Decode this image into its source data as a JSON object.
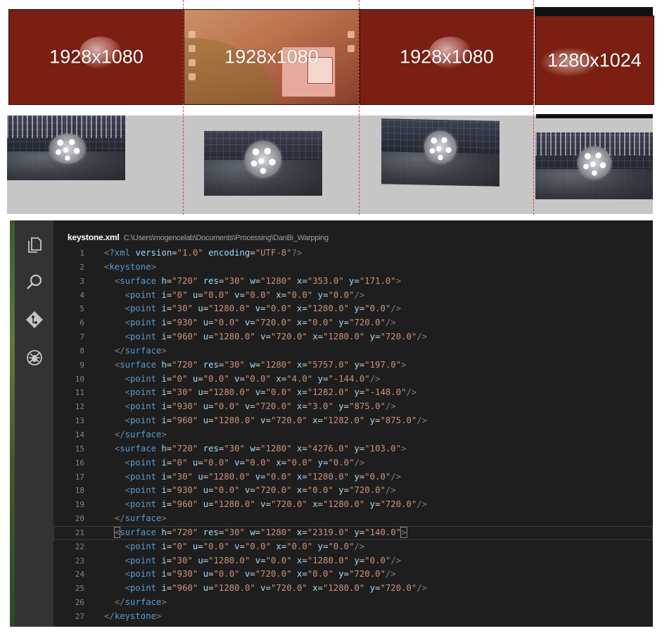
{
  "displays_top": [
    {
      "label": "1928x1080"
    },
    {
      "label": "1928x1080"
    },
    {
      "label": "1928x1080"
    },
    {
      "label": "1280x1024"
    }
  ],
  "colors": {
    "display_fill": "#7a1f12",
    "divider": "#e0403a",
    "warp_background": "#c6c6c6",
    "editor_bg": "#1e1e1e",
    "activity_bar": "#333333",
    "tag": "#569cd6",
    "attribute": "#9cdcfe",
    "string": "#ce9178"
  },
  "editor": {
    "file_name": "keystone.xml",
    "file_path": "C:\\Users\\mogencelab\\Documents\\Processing\\DanBi_Warpping",
    "activity_icons": [
      "explorer-icon",
      "search-icon",
      "source-control-icon",
      "debug-icon"
    ],
    "active_line": 21,
    "lines": [
      {
        "n": "1",
        "indent": 0,
        "kind": "decl",
        "tag": "?xml",
        "attrs": [
          [
            "version",
            "1.0"
          ],
          [
            "encoding",
            "UTF-8"
          ]
        ],
        "close": "?>"
      },
      {
        "n": "2",
        "indent": 0,
        "kind": "open",
        "tag": "keystone",
        "attrs": [],
        "close": ">"
      },
      {
        "n": "3",
        "indent": 1,
        "kind": "open",
        "tag": "surface",
        "attrs": [
          [
            "h",
            "720"
          ],
          [
            "res",
            "30"
          ],
          [
            "w",
            "1280"
          ],
          [
            "x",
            "353.0"
          ],
          [
            "y",
            "171.0"
          ]
        ],
        "close": ">"
      },
      {
        "n": "4",
        "indent": 2,
        "kind": "open",
        "tag": "point",
        "attrs": [
          [
            "i",
            "0"
          ],
          [
            "u",
            "0.0"
          ],
          [
            "v",
            "0.0"
          ],
          [
            "x",
            "0.0"
          ],
          [
            "y",
            "0.0"
          ]
        ],
        "close": "/>"
      },
      {
        "n": "5",
        "indent": 2,
        "kind": "open",
        "tag": "point",
        "attrs": [
          [
            "i",
            "30"
          ],
          [
            "u",
            "1280.0"
          ],
          [
            "v",
            "0.0"
          ],
          [
            "x",
            "1280.0"
          ],
          [
            "y",
            "0.0"
          ]
        ],
        "close": "/>"
      },
      {
        "n": "6",
        "indent": 2,
        "kind": "open",
        "tag": "point",
        "attrs": [
          [
            "i",
            "930"
          ],
          [
            "u",
            "0.0"
          ],
          [
            "v",
            "720.0"
          ],
          [
            "x",
            "0.0"
          ],
          [
            "y",
            "720.0"
          ]
        ],
        "close": "/>"
      },
      {
        "n": "7",
        "indent": 2,
        "kind": "open",
        "tag": "point",
        "attrs": [
          [
            "i",
            "960"
          ],
          [
            "u",
            "1280.0"
          ],
          [
            "v",
            "720.0"
          ],
          [
            "x",
            "1280.0"
          ],
          [
            "y",
            "720.0"
          ]
        ],
        "close": "/>"
      },
      {
        "n": "8",
        "indent": 1,
        "kind": "close",
        "tag": "surface"
      },
      {
        "n": "9",
        "indent": 1,
        "kind": "open",
        "tag": "surface",
        "attrs": [
          [
            "h",
            "720"
          ],
          [
            "res",
            "30"
          ],
          [
            "w",
            "1280"
          ],
          [
            "x",
            "5757.0"
          ],
          [
            "y",
            "197.0"
          ]
        ],
        "close": ">"
      },
      {
        "n": "10",
        "indent": 2,
        "kind": "open",
        "tag": "point",
        "attrs": [
          [
            "i",
            "0"
          ],
          [
            "u",
            "0.0"
          ],
          [
            "v",
            "0.0"
          ],
          [
            "x",
            "4.0"
          ],
          [
            "y",
            "-144.0"
          ]
        ],
        "close": "/>"
      },
      {
        "n": "11",
        "indent": 2,
        "kind": "open",
        "tag": "point",
        "attrs": [
          [
            "i",
            "30"
          ],
          [
            "u",
            "1280.0"
          ],
          [
            "v",
            "0.0"
          ],
          [
            "x",
            "1282.0"
          ],
          [
            "y",
            "-148.0"
          ]
        ],
        "close": "/>"
      },
      {
        "n": "12",
        "indent": 2,
        "kind": "open",
        "tag": "point",
        "attrs": [
          [
            "i",
            "930"
          ],
          [
            "u",
            "0.0"
          ],
          [
            "v",
            "720.0"
          ],
          [
            "x",
            "3.0"
          ],
          [
            "y",
            "875.0"
          ]
        ],
        "close": "/>"
      },
      {
        "n": "13",
        "indent": 2,
        "kind": "open",
        "tag": "point",
        "attrs": [
          [
            "i",
            "960"
          ],
          [
            "u",
            "1280.0"
          ],
          [
            "v",
            "720.0"
          ],
          [
            "x",
            "1282.0"
          ],
          [
            "y",
            "875.0"
          ]
        ],
        "close": "/>"
      },
      {
        "n": "14",
        "indent": 1,
        "kind": "close",
        "tag": "surface"
      },
      {
        "n": "15",
        "indent": 1,
        "kind": "open",
        "tag": "surface",
        "attrs": [
          [
            "h",
            "720"
          ],
          [
            "res",
            "30"
          ],
          [
            "w",
            "1280"
          ],
          [
            "x",
            "4276.0"
          ],
          [
            "y",
            "103.0"
          ]
        ],
        "close": ">"
      },
      {
        "n": "16",
        "indent": 2,
        "kind": "open",
        "tag": "point",
        "attrs": [
          [
            "i",
            "0"
          ],
          [
            "u",
            "0.0"
          ],
          [
            "v",
            "0.0"
          ],
          [
            "x",
            "0.0"
          ],
          [
            "y",
            "0.0"
          ]
        ],
        "close": "/>"
      },
      {
        "n": "17",
        "indent": 2,
        "kind": "open",
        "tag": "point",
        "attrs": [
          [
            "i",
            "30"
          ],
          [
            "u",
            "1280.0"
          ],
          [
            "v",
            "0.0"
          ],
          [
            "x",
            "1280.0"
          ],
          [
            "y",
            "0.0"
          ]
        ],
        "close": "/>"
      },
      {
        "n": "18",
        "indent": 2,
        "kind": "open",
        "tag": "point",
        "attrs": [
          [
            "i",
            "930"
          ],
          [
            "u",
            "0.0"
          ],
          [
            "v",
            "720.0"
          ],
          [
            "x",
            "0.0"
          ],
          [
            "y",
            "720.0"
          ]
        ],
        "close": "/>"
      },
      {
        "n": "19",
        "indent": 2,
        "kind": "open",
        "tag": "point",
        "attrs": [
          [
            "i",
            "960"
          ],
          [
            "u",
            "1280.0"
          ],
          [
            "v",
            "720.0"
          ],
          [
            "x",
            "1280.0"
          ],
          [
            "y",
            "720.0"
          ]
        ],
        "close": "/>"
      },
      {
        "n": "20",
        "indent": 1,
        "kind": "close",
        "tag": "surface"
      },
      {
        "n": "21",
        "indent": 1,
        "kind": "open",
        "tag": "surface",
        "attrs": [
          [
            "h",
            "720"
          ],
          [
            "res",
            "30"
          ],
          [
            "w",
            "1280"
          ],
          [
            "x",
            "2319.0"
          ],
          [
            "y",
            "140.0"
          ]
        ],
        "close": ">"
      },
      {
        "n": "22",
        "indent": 2,
        "kind": "open",
        "tag": "point",
        "attrs": [
          [
            "i",
            "0"
          ],
          [
            "u",
            "0.0"
          ],
          [
            "v",
            "0.0"
          ],
          [
            "x",
            "0.0"
          ],
          [
            "y",
            "0.0"
          ]
        ],
        "close": "/>"
      },
      {
        "n": "23",
        "indent": 2,
        "kind": "open",
        "tag": "point",
        "attrs": [
          [
            "i",
            "30"
          ],
          [
            "u",
            "1280.0"
          ],
          [
            "v",
            "0.0"
          ],
          [
            "x",
            "1280.0"
          ],
          [
            "y",
            "0.0"
          ]
        ],
        "close": "/>"
      },
      {
        "n": "24",
        "indent": 2,
        "kind": "open",
        "tag": "point",
        "attrs": [
          [
            "i",
            "930"
          ],
          [
            "u",
            "0.0"
          ],
          [
            "v",
            "720.0"
          ],
          [
            "x",
            "0.0"
          ],
          [
            "y",
            "720.0"
          ]
        ],
        "close": "/>"
      },
      {
        "n": "25",
        "indent": 2,
        "kind": "open",
        "tag": "point",
        "attrs": [
          [
            "i",
            "960"
          ],
          [
            "u",
            "1280.0"
          ],
          [
            "v",
            "720.0"
          ],
          [
            "x",
            "1280.0"
          ],
          [
            "y",
            "720.0"
          ]
        ],
        "close": "/>"
      },
      {
        "n": "26",
        "indent": 1,
        "kind": "close",
        "tag": "surface"
      },
      {
        "n": "27",
        "indent": 0,
        "kind": "close",
        "tag": "keystone"
      }
    ]
  }
}
